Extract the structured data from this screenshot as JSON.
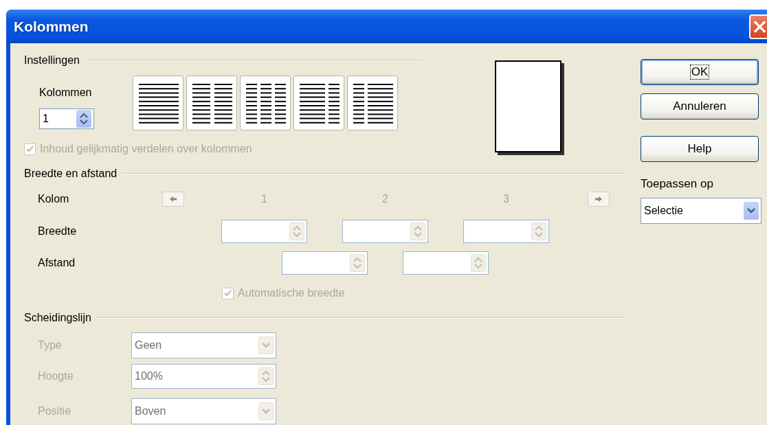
{
  "window": {
    "title": "Kolommen"
  },
  "settings": {
    "legend": "Instellingen",
    "columns_label": "Kolommen",
    "columns_value": "1",
    "presets": [
      {
        "kind": "single"
      },
      {
        "kind": "double"
      },
      {
        "kind": "triple"
      },
      {
        "kind": "wide-left"
      },
      {
        "kind": "wide-right"
      }
    ],
    "even_distribution": {
      "label": "Inhoud gelijkmatig verdelen over kolommen",
      "checked": true,
      "disabled": true
    }
  },
  "width_spacing": {
    "legend": "Breedte en afstand",
    "column_label": "Kolom",
    "nav_disabled": true,
    "columns": [
      {
        "number": "1",
        "disabled": true
      },
      {
        "number": "2",
        "disabled": true
      },
      {
        "number": "3",
        "disabled": true
      }
    ],
    "width_label": "Breedte",
    "width_fields": [
      {
        "disabled": true
      },
      {
        "disabled": true
      },
      {
        "disabled": true
      }
    ],
    "spacing_label": "Afstand",
    "spacing_fields": [
      {
        "disabled": true
      },
      {
        "disabled": true
      }
    ],
    "auto_width": {
      "label": "Automatische breedte",
      "checked": true,
      "disabled": true
    }
  },
  "separator": {
    "legend": "Scheidingslijn",
    "fields": [
      {
        "label": "Type",
        "kind": "dropdown",
        "value": "Geen",
        "disabled": true
      },
      {
        "label": "Hoogte",
        "kind": "spin",
        "value": "100%",
        "disabled": true
      },
      {
        "label": "Positie",
        "kind": "dropdown",
        "value": "Boven",
        "disabled": true
      }
    ]
  },
  "buttons": [
    {
      "label": "OK",
      "default": true,
      "focused": true
    },
    {
      "label": "Annuleren",
      "default": false,
      "focused": false
    },
    {
      "label": "Help",
      "default": false,
      "focused": false
    }
  ],
  "apply_to": {
    "label": "Toepassen op",
    "value": "Selectie"
  }
}
